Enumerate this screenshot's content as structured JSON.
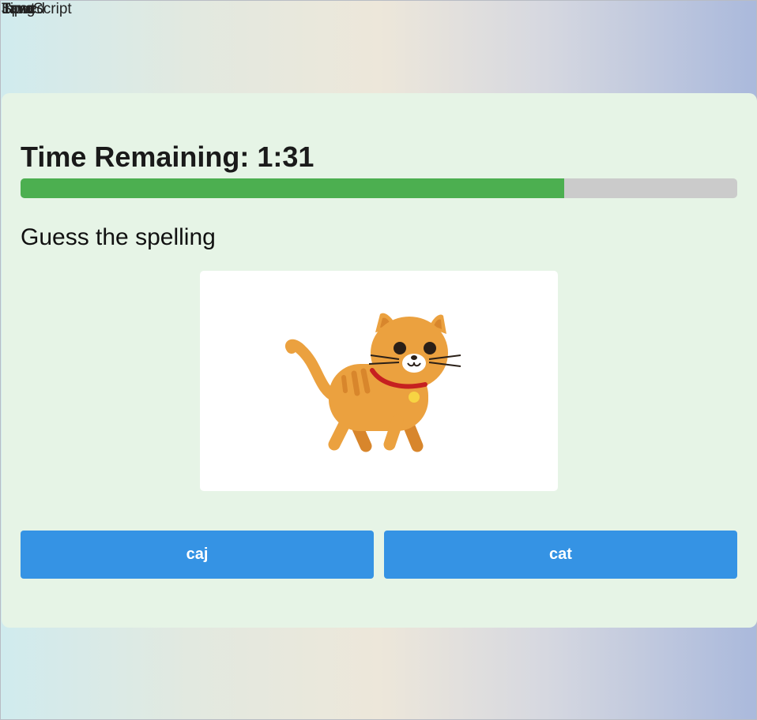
{
  "overlap_labels": [
    "Time",
    "Speed",
    "Lang",
    "Input",
    "JavaScript"
  ],
  "quiz": {
    "timer_label": "Time Remaining: 1:31",
    "progress_fraction": 0.758,
    "prompt": "Guess the spelling",
    "image_icon": "cat-illustration",
    "choices": [
      "caj",
      "cat"
    ]
  },
  "colors": {
    "card_bg": "#e6f4e6",
    "progress_fill": "#4caf50",
    "progress_track": "#cbcbcb",
    "button_bg": "#3593e4"
  }
}
